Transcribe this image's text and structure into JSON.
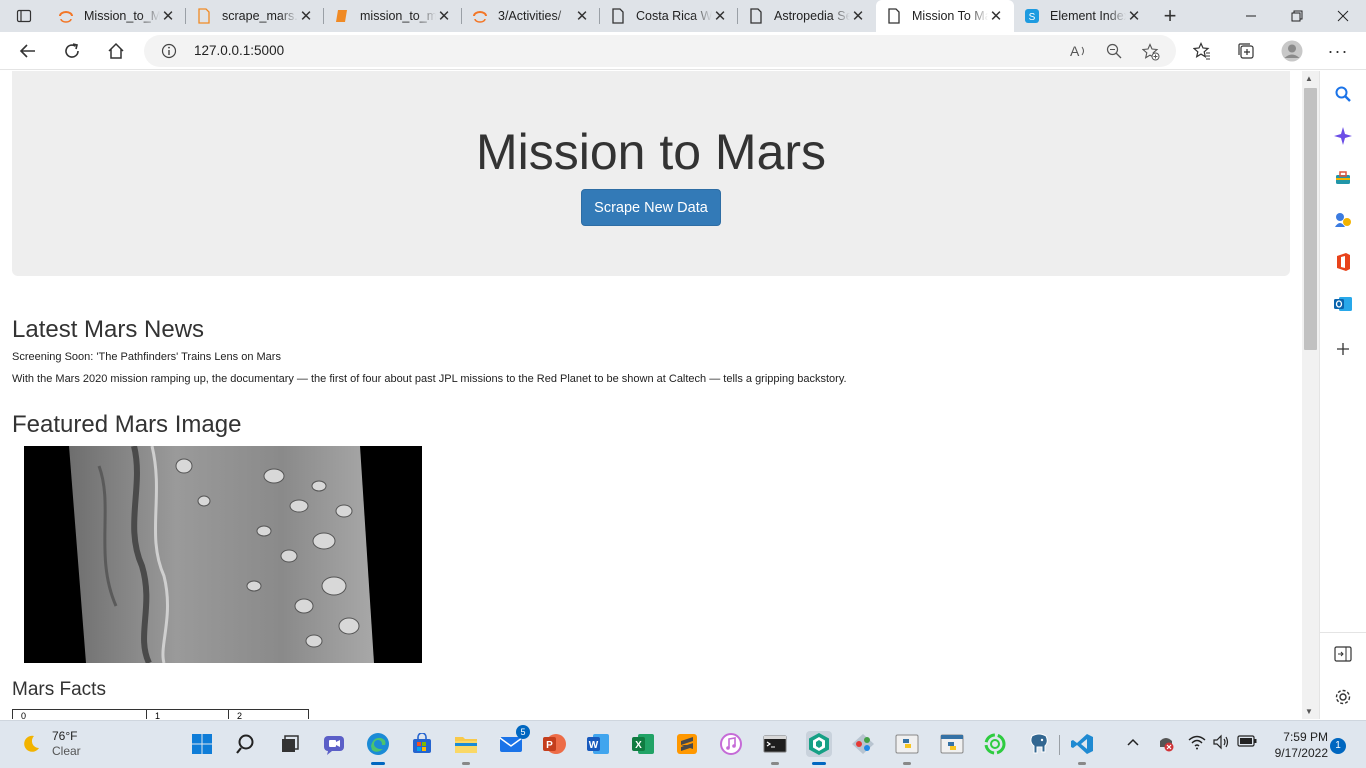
{
  "browser": {
    "tabs": [
      {
        "title": "Mission_to_Mars",
        "icon": "jupyter-icon"
      },
      {
        "title": "scrape_mars.py",
        "icon": "file-icon"
      },
      {
        "title": "mission_to_mars",
        "icon": "notebook-icon"
      },
      {
        "title": "3/Activities/",
        "icon": "jupyter-icon"
      },
      {
        "title": "Costa Rica Weather",
        "icon": "page-icon"
      },
      {
        "title": "Astropedia Search",
        "icon": "page-icon"
      },
      {
        "title": "Mission To Mars",
        "icon": "page-icon",
        "active": true
      },
      {
        "title": "Element Index",
        "icon": "site-icon"
      }
    ],
    "address": "127.0.0.1:5000"
  },
  "page": {
    "title": "Mission to Mars",
    "scrape_button": "Scrape New Data",
    "news_heading": "Latest Mars News",
    "news_title": "Screening Soon: 'The Pathfinders' Trains Lens on Mars",
    "news_paragraph": "With the Mars 2020 mission ramping up, the documentary — the first of four about past JPL missions to the Red Planet to be shown at Caltech — tells a gripping backstory.",
    "image_heading": "Featured Mars Image",
    "facts_heading": "Mars Facts",
    "facts_columns": [
      "0",
      "1",
      "2"
    ]
  },
  "taskbar": {
    "weather_temp": "76°F",
    "weather_desc": "Clear",
    "mail_badge": "5",
    "time": "7:59 PM",
    "date": "9/17/2022",
    "notification_count": "1"
  },
  "colors": {
    "button": "#337ab7",
    "jumbotron": "#eeeeee",
    "accent": "#0067c0"
  }
}
